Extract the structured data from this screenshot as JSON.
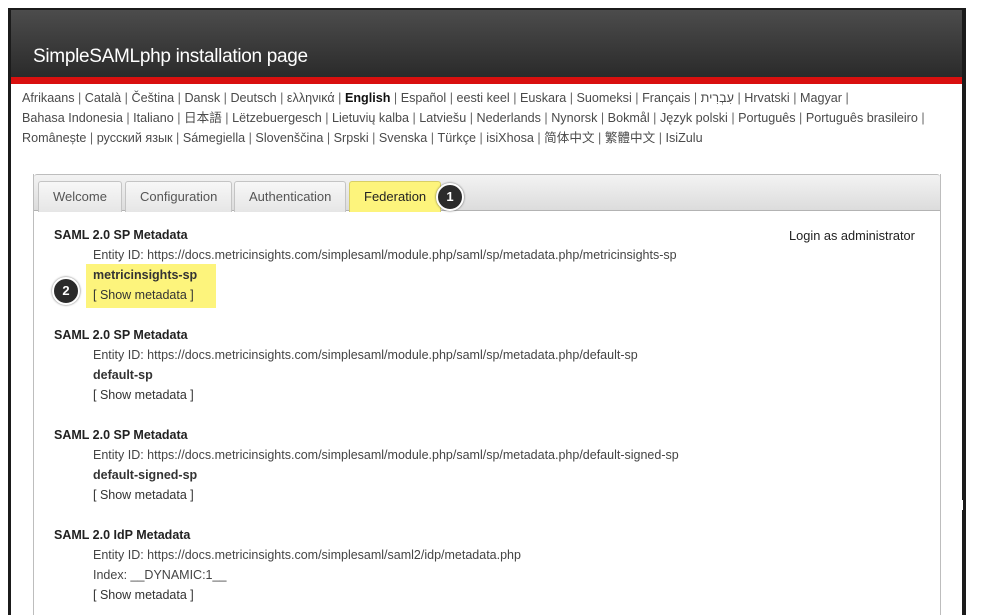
{
  "header": {
    "title": "SimpleSAMLphp installation page"
  },
  "languages": [
    {
      "label": "Afrikaans"
    },
    {
      "label": "Català"
    },
    {
      "label": "Čeština"
    },
    {
      "label": "Dansk"
    },
    {
      "label": "Deutsch"
    },
    {
      "label": "ελληνικά"
    },
    {
      "label": "English",
      "current": true
    },
    {
      "label": "Español"
    },
    {
      "label": "eesti keel"
    },
    {
      "label": "Euskara"
    },
    {
      "label": "Suomeksi"
    },
    {
      "label": "Français"
    },
    {
      "label": "עִבְרִית"
    },
    {
      "label": "Hrvatski"
    },
    {
      "label": "Magyar"
    },
    {
      "label": "Bahasa Indonesia"
    },
    {
      "label": "Italiano"
    },
    {
      "label": "日本語"
    },
    {
      "label": "Lëtzebuergesch"
    },
    {
      "label": "Lietuvių kalba"
    },
    {
      "label": "Latviešu"
    },
    {
      "label": "Nederlands"
    },
    {
      "label": "Nynorsk"
    },
    {
      "label": "Bokmål"
    },
    {
      "label": "Język polski"
    },
    {
      "label": "Português"
    },
    {
      "label": "Português brasileiro"
    },
    {
      "label": "Românește"
    },
    {
      "label": "русский язык"
    },
    {
      "label": "Sámegiella"
    },
    {
      "label": "Slovenščina"
    },
    {
      "label": "Srpski"
    },
    {
      "label": "Svenska"
    },
    {
      "label": "Türkçe"
    },
    {
      "label": "isiXhosa"
    },
    {
      "label": "简体中文"
    },
    {
      "label": "繁體中文"
    },
    {
      "label": "IsiZulu"
    }
  ],
  "tabs": [
    {
      "label": "Welcome"
    },
    {
      "label": "Configuration"
    },
    {
      "label": "Authentication"
    },
    {
      "label": "Federation",
      "active": true
    }
  ],
  "callouts": {
    "one": "1",
    "two": "2"
  },
  "login_link": "Login as administrator",
  "colors": {
    "highlight": "#fdf47c",
    "header_red": "#d9100f"
  },
  "entries": [
    {
      "title": "SAML 2.0 SP Metadata",
      "entity": "Entity ID: https://docs.metricinsights.com/simplesaml/module.php/saml/sp/metadata.php/metricinsights-sp",
      "name": "metricinsights-sp",
      "show": "[ Show metadata ]"
    },
    {
      "title": "SAML 2.0 SP Metadata",
      "entity": "Entity ID: https://docs.metricinsights.com/simplesaml/module.php/saml/sp/metadata.php/default-sp",
      "name": "default-sp",
      "show": "[ Show metadata ]"
    },
    {
      "title": "SAML 2.0 SP Metadata",
      "entity": "Entity ID: https://docs.metricinsights.com/simplesaml/module.php/saml/sp/metadata.php/default-signed-sp",
      "name": "default-signed-sp",
      "show": "[ Show metadata ]"
    },
    {
      "title": "SAML 2.0 IdP Metadata",
      "entity": "Entity ID: https://docs.metricinsights.com/simplesaml/saml2/idp/metadata.php",
      "name": "Index: __DYNAMIC:1__",
      "show": "[ Show metadata ]"
    }
  ]
}
